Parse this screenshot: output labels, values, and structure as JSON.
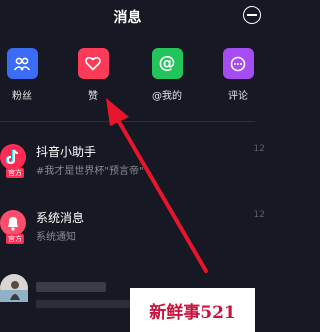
{
  "header": {
    "title": "消息"
  },
  "categories": [
    {
      "label": "粉丝",
      "icon": "fans-icon",
      "color": "#3b6cf6"
    },
    {
      "label": "赞",
      "icon": "heart-icon",
      "color": "#fd3a58"
    },
    {
      "label": "@我的",
      "icon": "at-icon",
      "color": "#23c45b"
    },
    {
      "label": "评论",
      "icon": "comment-icon",
      "color": "#a64cf3"
    }
  ],
  "messages": [
    {
      "title": "抖音小助手",
      "subtitle": "#我才是世界杯\"预言帝\"",
      "badge": "官方",
      "time": "12"
    },
    {
      "title": "系统消息",
      "subtitle": "系统通知",
      "badge": "官方",
      "time": "12"
    }
  ],
  "watermark": "新鲜事521",
  "colors": {
    "background": "#161823",
    "accent": "#fe2c55",
    "arrow": "#e8152b"
  }
}
